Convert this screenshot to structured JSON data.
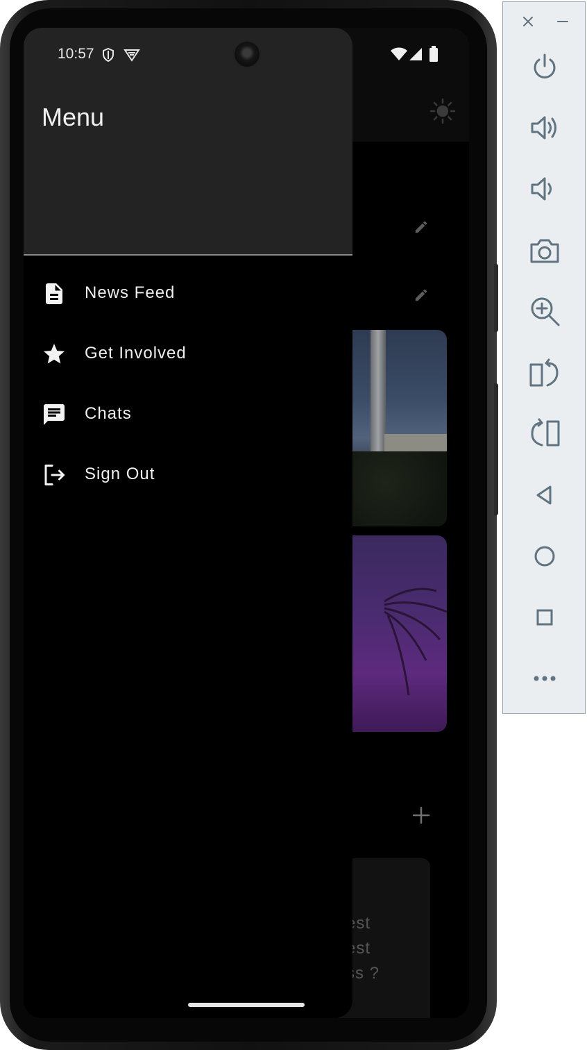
{
  "status_bar": {
    "time": "10:57"
  },
  "drawer": {
    "title": "Menu",
    "items": [
      {
        "label": "News Feed",
        "icon": "article-icon"
      },
      {
        "label": "Get Involved",
        "icon": "star-icon"
      },
      {
        "label": "Chats",
        "icon": "chat-icon"
      },
      {
        "label": "Sign Out",
        "icon": "logout-icon"
      }
    ]
  },
  "background_app": {
    "note_lines": [
      "est",
      "est",
      "ss ?"
    ]
  },
  "emulator_toolbar": {
    "buttons": [
      "power-icon",
      "volume-up-icon",
      "volume-down-icon",
      "camera-icon",
      "zoom-in-icon",
      "rotate-left-icon",
      "rotate-right-icon",
      "back-icon",
      "home-icon",
      "overview-icon",
      "more-icon"
    ]
  },
  "colors": {
    "drawer_header_bg": "#232323",
    "drawer_bg": "#000000",
    "text": "#eeeeee",
    "emulator_icon": "#5f7380"
  }
}
